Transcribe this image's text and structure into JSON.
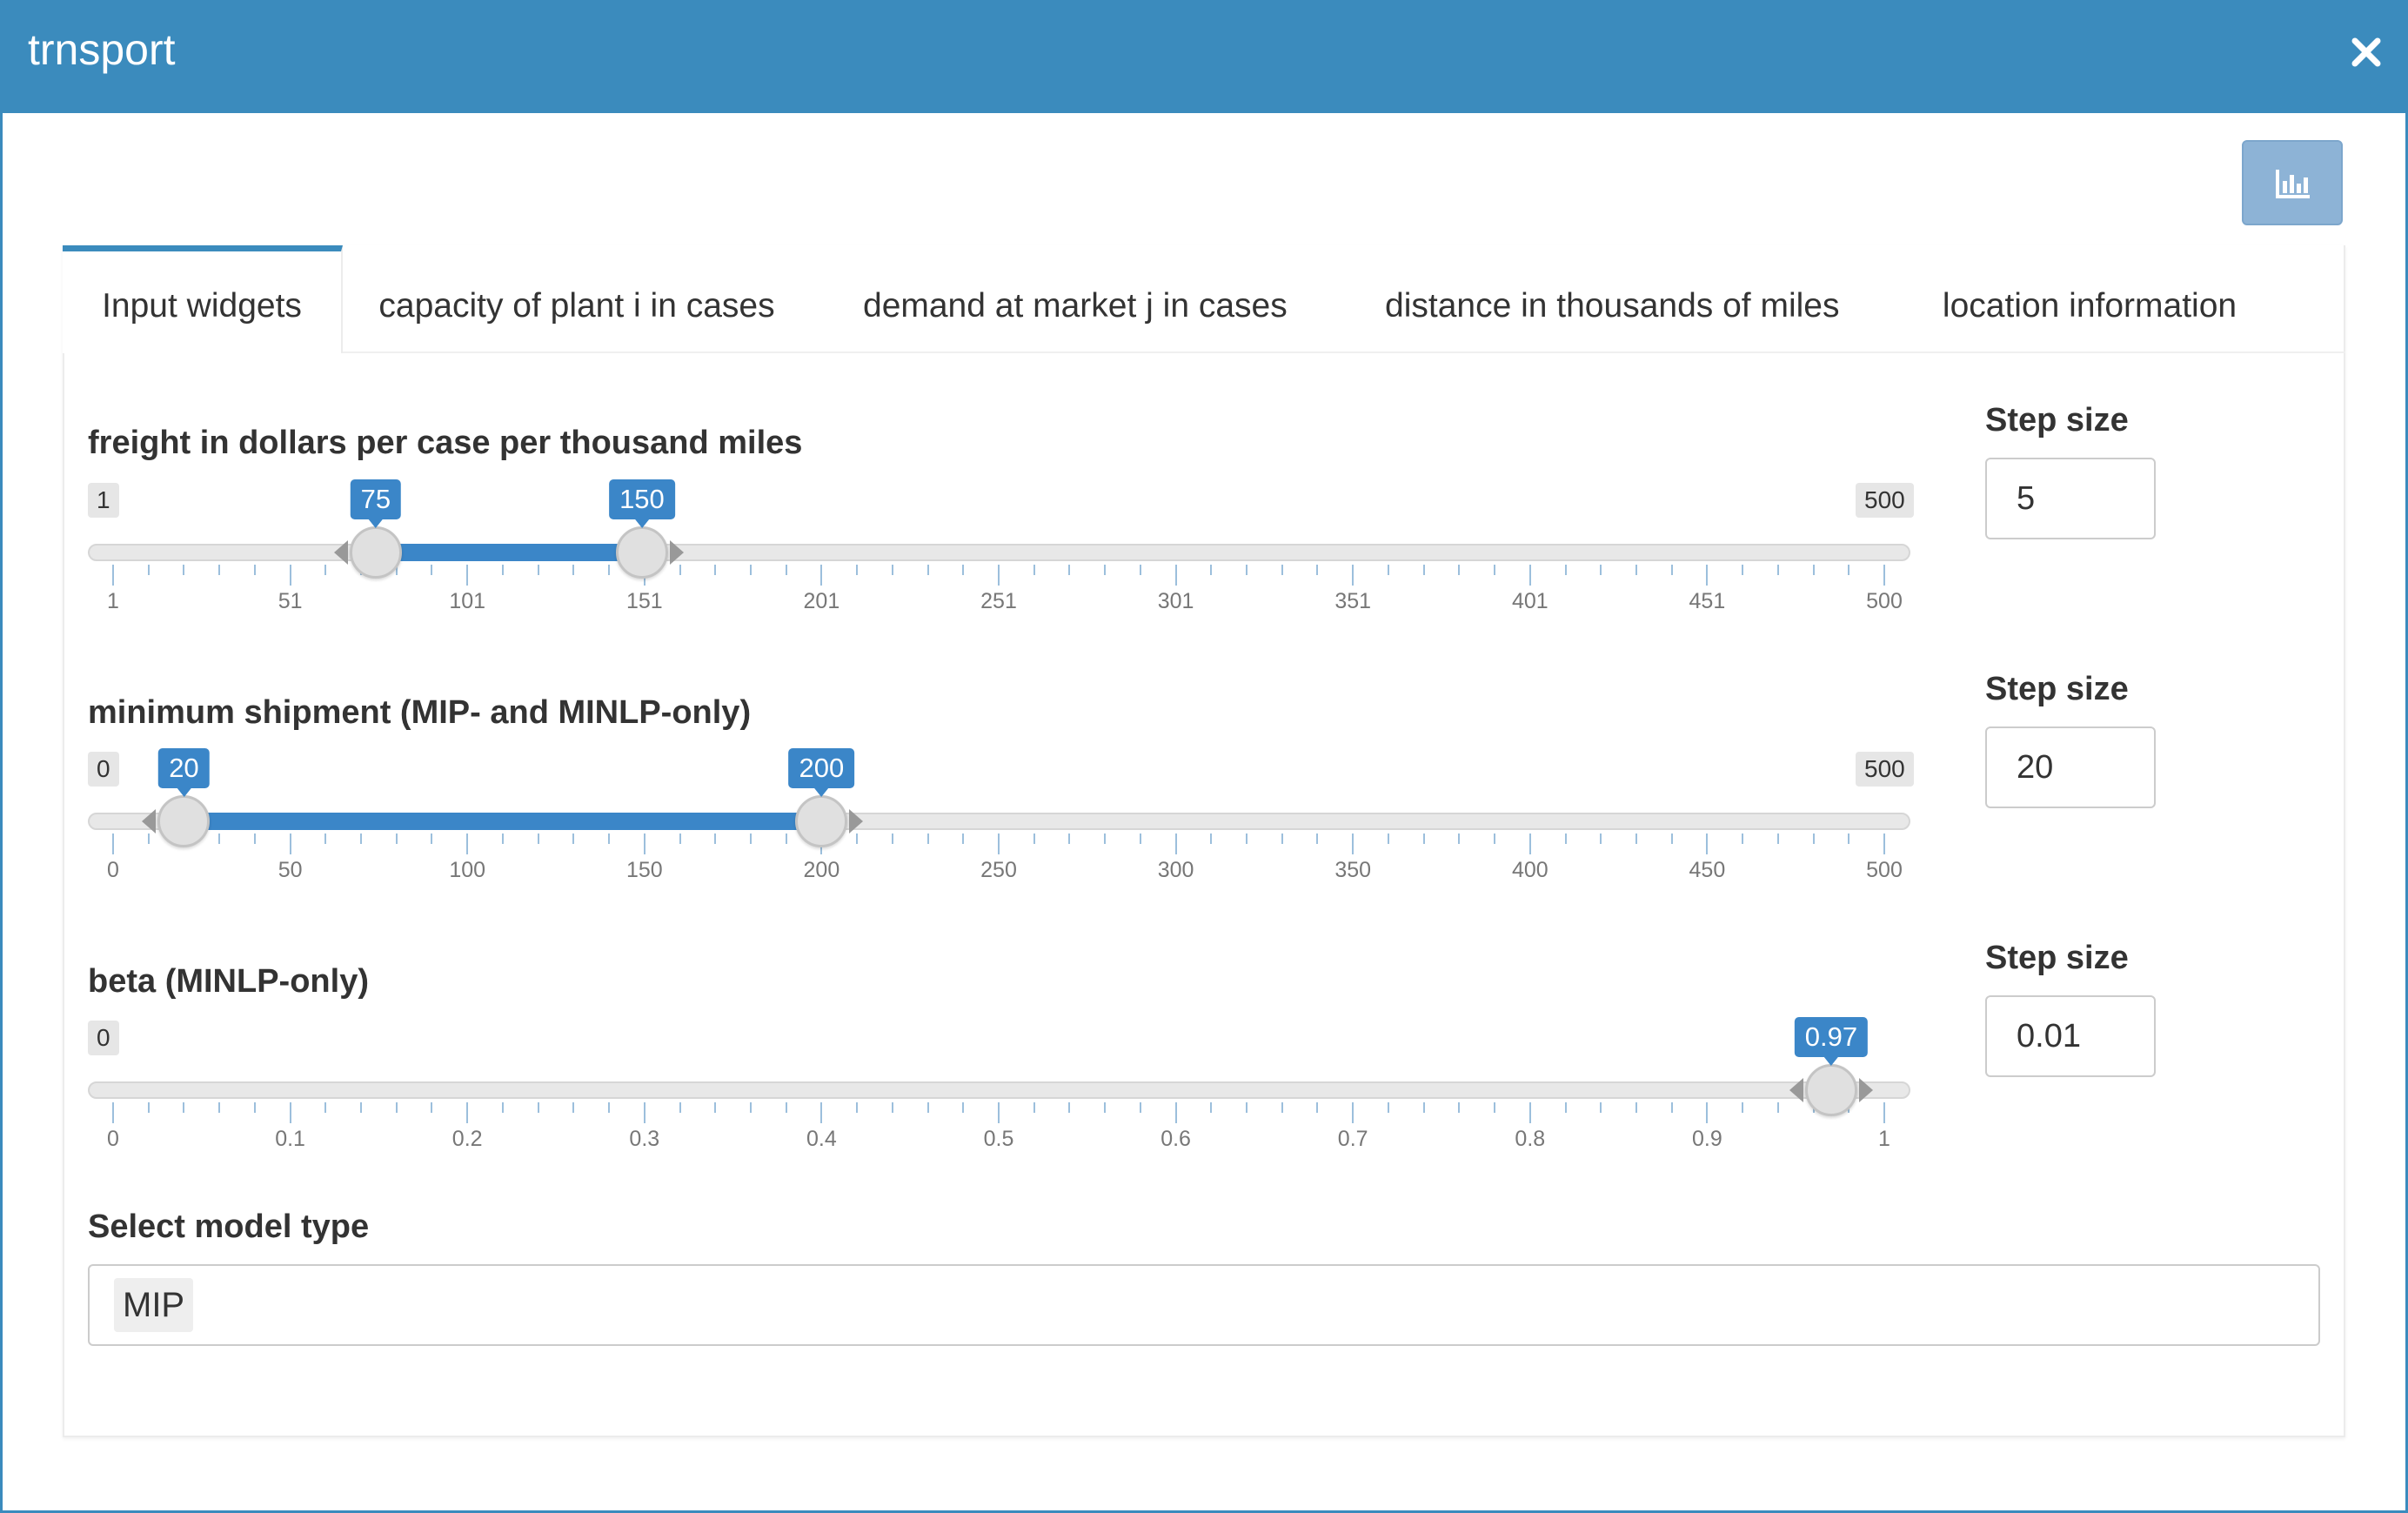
{
  "window": {
    "title": "trnsport"
  },
  "icons": {
    "close": "close-icon",
    "chart": "bar-chart-icon"
  },
  "colors": {
    "accent": "#3b8bbd",
    "slider_bar": "#3b86c8",
    "chart_button": "#8db3d6"
  },
  "tabs": [
    {
      "label": "Input widgets",
      "active": true
    },
    {
      "label": "capacity of plant i in cases",
      "active": false
    },
    {
      "label": "demand at market j in cases",
      "active": false
    },
    {
      "label": "distance in thousands of miles",
      "active": false
    },
    {
      "label": "location information",
      "active": false
    }
  ],
  "sliders": [
    {
      "label": "freight in dollars per case per thousand miles",
      "min": 1,
      "max": 500,
      "min_label": "1",
      "max_label": "500",
      "from": 75,
      "to": 150,
      "from_label": "75",
      "to_label": "150",
      "ticks": [
        "1",
        "51",
        "101",
        "151",
        "201",
        "251",
        "301",
        "351",
        "401",
        "451",
        "500"
      ],
      "step_label": "Step size",
      "step_value": "5"
    },
    {
      "label": "minimum shipment (MIP- and MINLP-only)",
      "min": 0,
      "max": 500,
      "min_label": "0",
      "max_label": "500",
      "from": 20,
      "to": 200,
      "from_label": "20",
      "to_label": "200",
      "ticks": [
        "0",
        "50",
        "100",
        "150",
        "200",
        "250",
        "300",
        "350",
        "400",
        "450",
        "500"
      ],
      "step_label": "Step size",
      "step_value": "20"
    },
    {
      "label": "beta (MINLP-only)",
      "min": 0,
      "max": 1,
      "min_label": "0",
      "max_label": "1",
      "value": 0.97,
      "value_label": "0.97",
      "ticks": [
        "0",
        "0.1",
        "0.2",
        "0.3",
        "0.4",
        "0.5",
        "0.6",
        "0.7",
        "0.8",
        "0.9",
        "1"
      ],
      "step_label": "Step size",
      "step_value": "0.01"
    }
  ],
  "model_select": {
    "label": "Select model type",
    "selected": "MIP"
  }
}
